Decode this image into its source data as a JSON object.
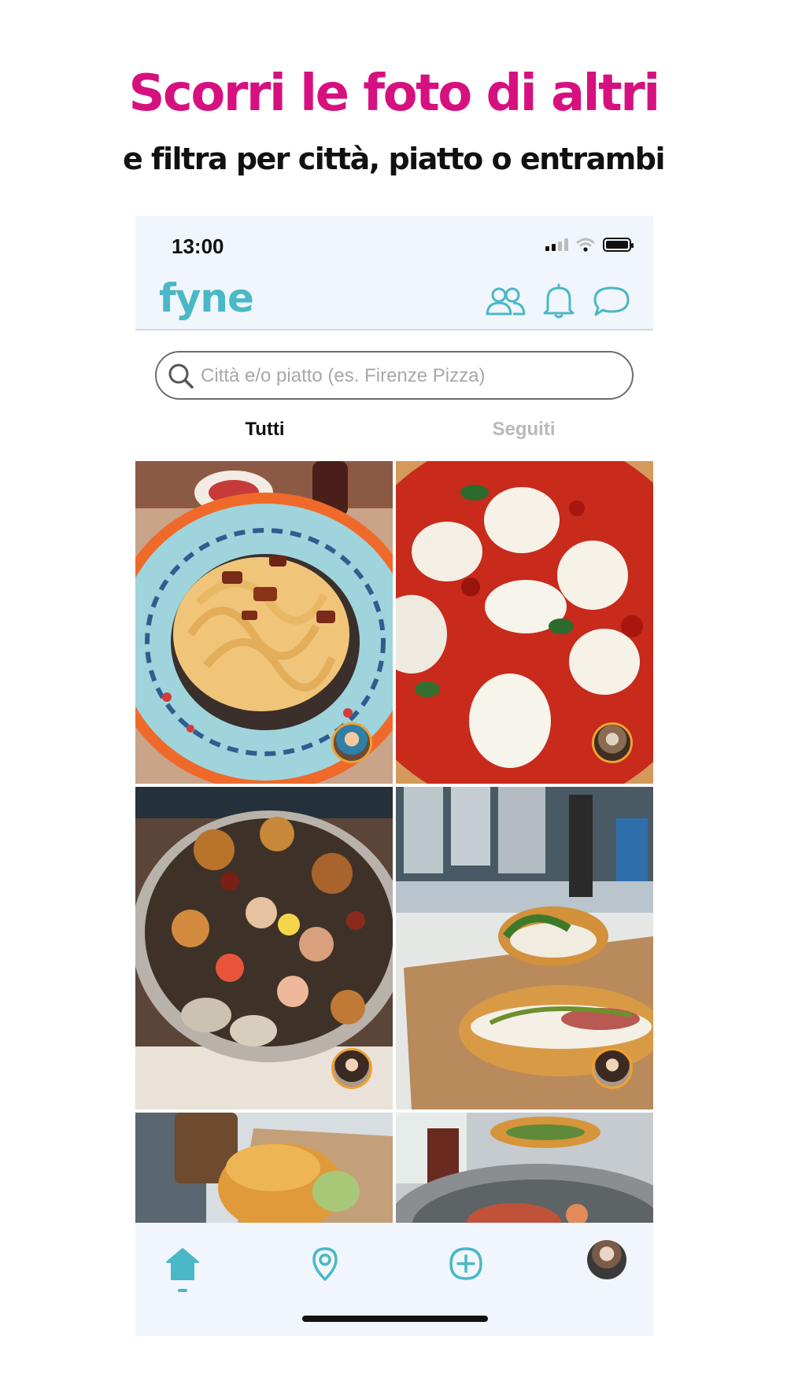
{
  "headline": "Scorri le foto di altri",
  "subheadline": "e filtra per città, piatto o entrambi",
  "status_bar": {
    "time": "13:00"
  },
  "app": {
    "logo": "fyne"
  },
  "header_icons": [
    "people-icon",
    "bell-icon",
    "chat-icon"
  ],
  "search": {
    "placeholder": "Città e/o piatto (es. Firenze Pizza)",
    "value": ""
  },
  "tabs": [
    {
      "label": "Tutti",
      "active": true
    },
    {
      "label": "Seguiti",
      "active": false
    }
  ],
  "feed": {
    "tiles": [
      {
        "dish": "pasta-carbonara-photo"
      },
      {
        "dish": "pizza-margherita-photo"
      },
      {
        "dish": "seafood-platter-photo"
      },
      {
        "dish": "sandwich-photo"
      },
      {
        "dish": "burger-photo"
      },
      {
        "dish": "dish-plate-photo"
      }
    ]
  },
  "bottom_nav": [
    "home-icon",
    "map-pin-icon",
    "add-post-icon",
    "profile-avatar"
  ],
  "colors": {
    "brand": "#4ab8c6",
    "headline": "#d6117f",
    "avatar_ring": "#f2a030",
    "bar_bg": "#f1f6fc"
  }
}
